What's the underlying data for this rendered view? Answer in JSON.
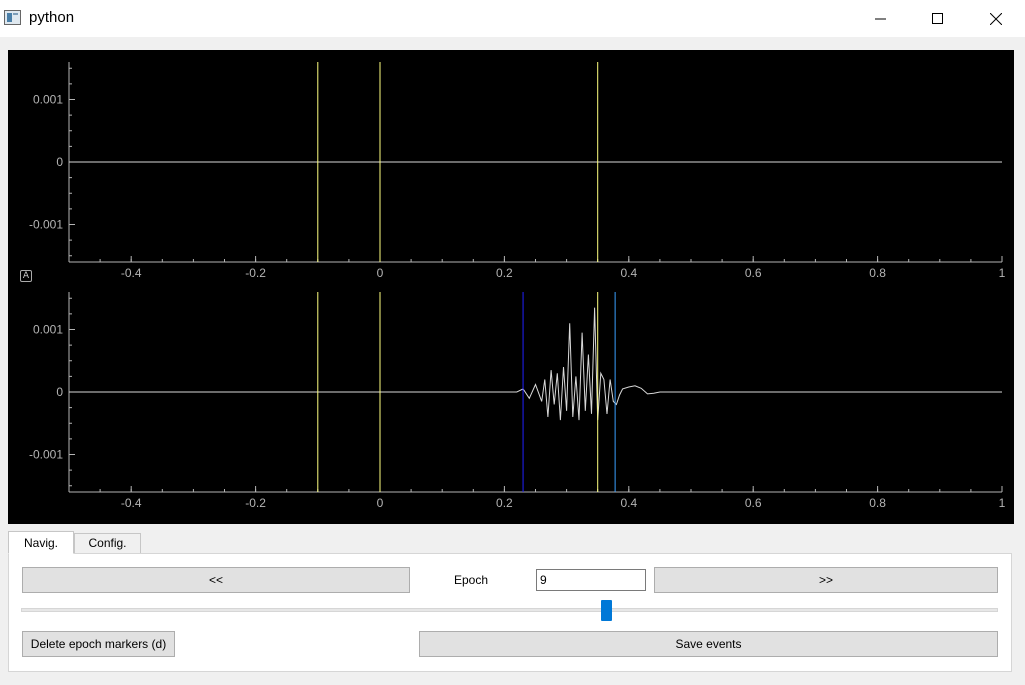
{
  "window": {
    "title": "python",
    "minimize": "–",
    "maximize": "□",
    "close": "✕"
  },
  "plots": {
    "x_ticks": [
      "-0.4",
      "-0.2",
      "0",
      "0.2",
      "0.4",
      "0.6",
      "0.8",
      "1"
    ],
    "y_ticks": [
      "0.001",
      "0",
      "-0.001"
    ],
    "auto_button": "A"
  },
  "chart_data": [
    {
      "type": "line",
      "xlim": [
        -0.5,
        1.0
      ],
      "ylim": [
        -0.0016,
        0.0016
      ],
      "grid": false,
      "series": [
        {
          "x": [
            -0.5,
            1.0
          ],
          "y": [
            0,
            0
          ]
        }
      ],
      "markers": [
        {
          "x": -0.1,
          "color": "#ffff80"
        },
        {
          "x": 0,
          "color": "#ffff80"
        },
        {
          "x": 0.35,
          "color": "#ffff80"
        }
      ]
    },
    {
      "type": "line",
      "xlim": [
        -0.5,
        1.0
      ],
      "ylim": [
        -0.0016,
        0.0016
      ],
      "grid": false,
      "series": [
        {
          "x": [
            -0.5,
            0.22,
            0.23,
            0.24,
            0.25,
            0.26,
            0.265,
            0.27,
            0.275,
            0.28,
            0.285,
            0.29,
            0.295,
            0.3,
            0.305,
            0.31,
            0.315,
            0.32,
            0.325,
            0.33,
            0.335,
            0.34,
            0.345,
            0.35,
            0.355,
            0.36,
            0.365,
            0.37,
            0.375,
            0.38,
            0.385,
            0.39,
            0.4,
            0.41,
            0.42,
            0.43,
            0.44,
            0.45,
            0.5,
            1.0
          ],
          "y": [
            0,
            0,
            5e-05,
            -0.0001,
            0.00012,
            -0.00015,
            0.0002,
            -0.0004,
            0.00035,
            -0.0002,
            0.0003,
            -0.00045,
            0.0004,
            -0.0003,
            0.0011,
            -0.0004,
            0.00025,
            -0.00045,
            0.00095,
            -0.0003,
            0.0006,
            -0.00035,
            0.00135,
            -0.00045,
            0.0003,
            0.0002,
            -0.00035,
            0.0002,
            -0.00015,
            -0.0002,
            -5e-05,
            5e-05,
            8e-05,
            0.0001,
            6e-05,
            -3e-05,
            -2e-05,
            0,
            0,
            0
          ]
        }
      ],
      "markers": [
        {
          "x": -0.1,
          "color": "#ffff80"
        },
        {
          "x": 0,
          "color": "#ffff80"
        },
        {
          "x": 0.23,
          "color": "#2020ff"
        },
        {
          "x": 0.35,
          "color": "#ffff80"
        },
        {
          "x": 0.378,
          "color": "#3aa0ff"
        }
      ]
    }
  ],
  "tabs": [
    {
      "label": "Navig.",
      "active": true
    },
    {
      "label": "Config.",
      "active": false
    }
  ],
  "nav": {
    "prev_label": "<<",
    "next_label": ">>",
    "epoch_label": "Epoch",
    "epoch_value": "9",
    "slider_fraction": 0.6,
    "delete_label": "Delete epoch markers (d)",
    "save_label": "Save events"
  }
}
